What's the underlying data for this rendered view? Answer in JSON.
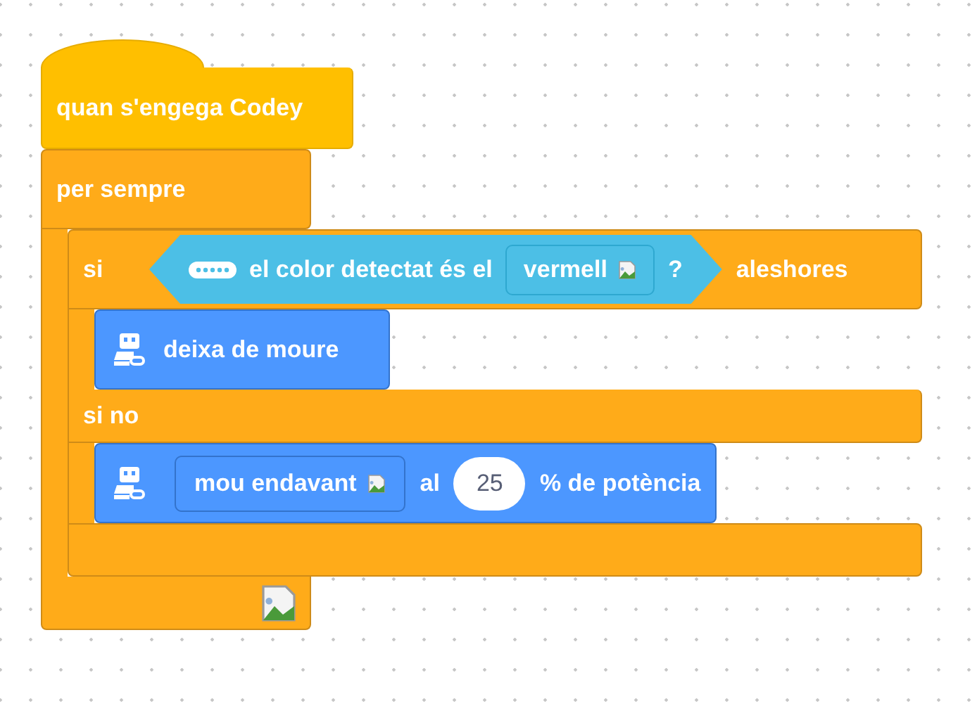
{
  "hat": {
    "label": "quan s'engega Codey"
  },
  "forever": {
    "label": "per sempre"
  },
  "if_else": {
    "if_label": "si",
    "condition": {
      "label": "el color detectat és el",
      "dropdown": "vermell",
      "suffix": "?"
    },
    "then_label": "aleshores",
    "else_label": "si no",
    "then_blocks": [
      {
        "kind": "stop",
        "label": "deixa de moure"
      }
    ],
    "else_blocks": [
      {
        "kind": "move",
        "dropdown": "mou endavant",
        "prep": "al",
        "value": "25",
        "suffix": "% de potència"
      }
    ]
  }
}
